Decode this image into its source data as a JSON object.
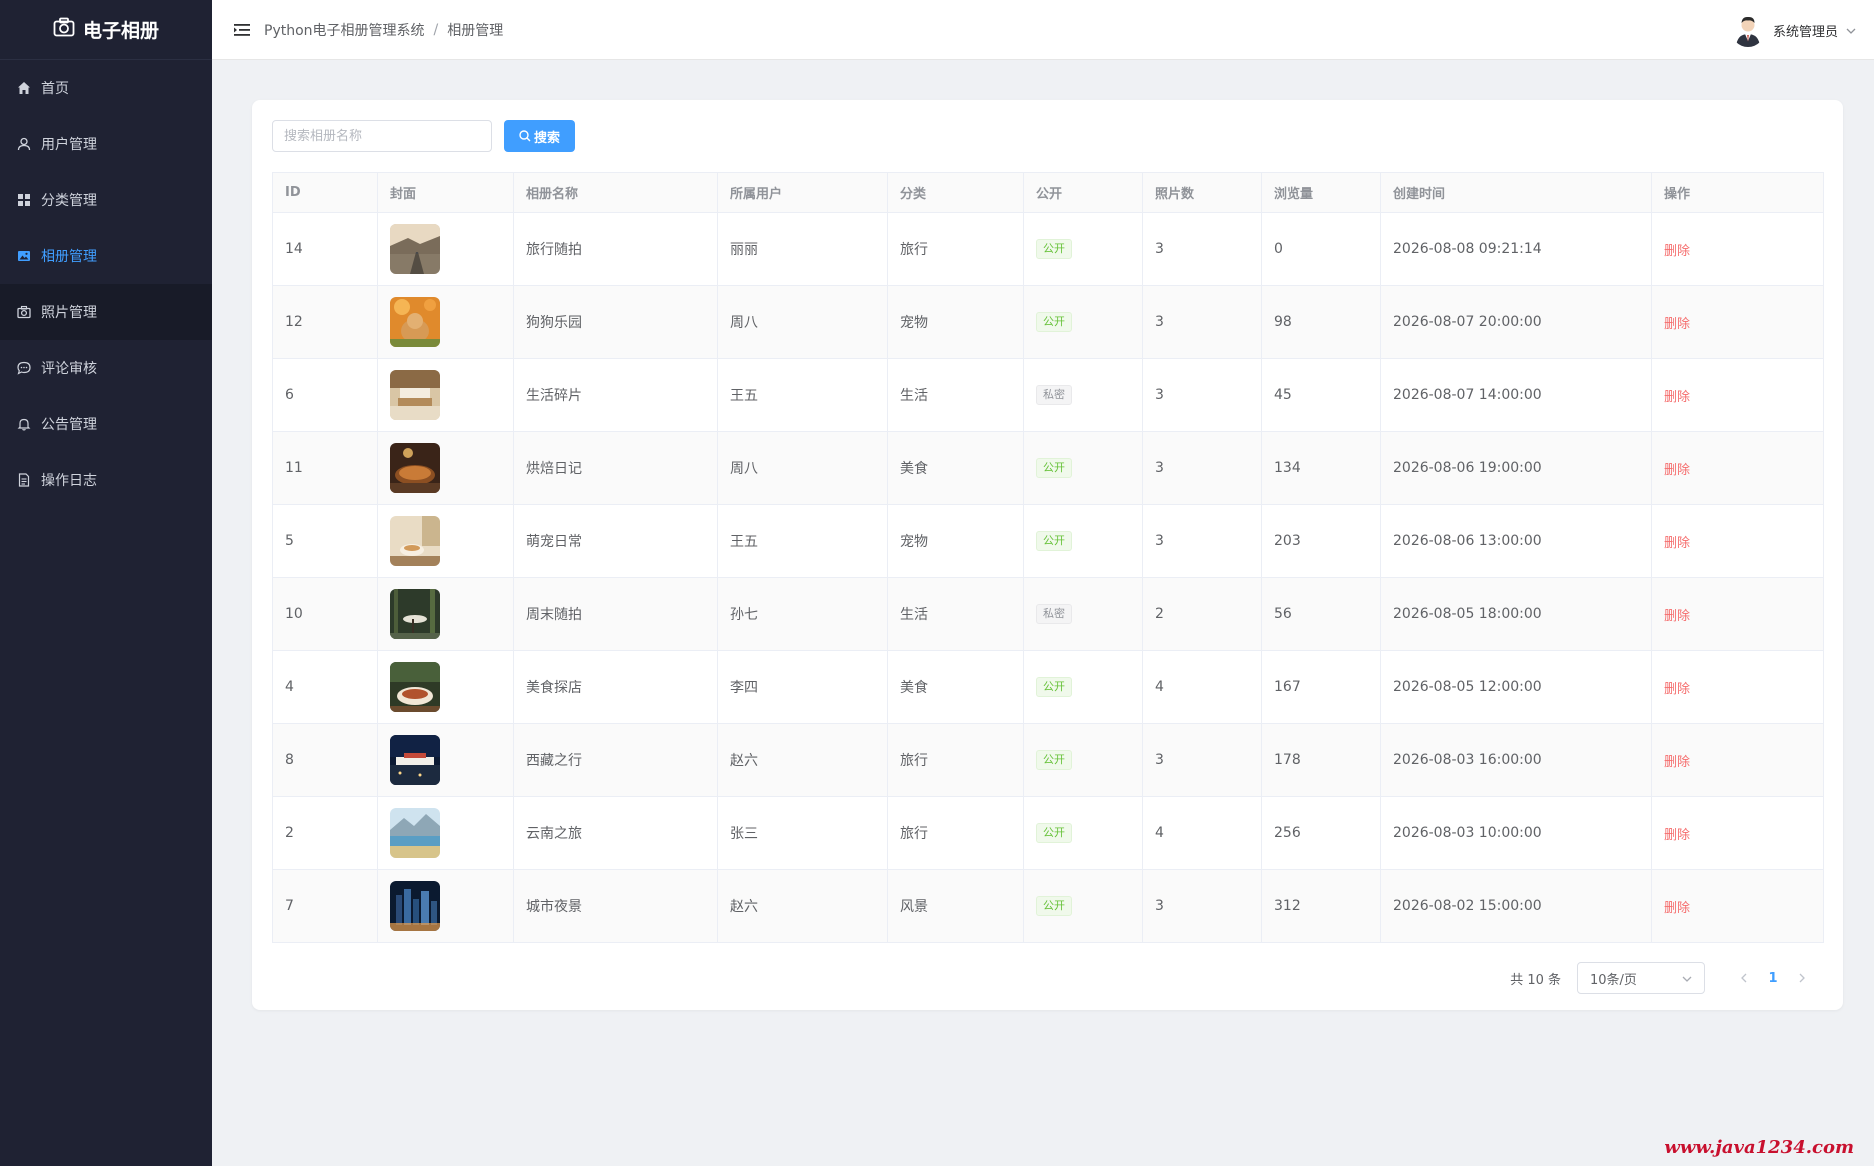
{
  "sidebar": {
    "logo": "电子相册",
    "items": [
      {
        "label": "首页",
        "icon": "home-icon"
      },
      {
        "label": "用户管理",
        "icon": "user-icon"
      },
      {
        "label": "分类管理",
        "icon": "grid-icon"
      },
      {
        "label": "相册管理",
        "icon": "picture-icon"
      },
      {
        "label": "照片管理",
        "icon": "camera-icon"
      },
      {
        "label": "评论审核",
        "icon": "comment-icon"
      },
      {
        "label": "公告管理",
        "icon": "bell-icon"
      },
      {
        "label": "操作日志",
        "icon": "document-icon"
      }
    ],
    "active_index": 3
  },
  "header": {
    "breadcrumb_root": "Python电子相册管理系统",
    "breadcrumb_sep": "/",
    "breadcrumb_current": "相册管理",
    "user_name": "系统管理员"
  },
  "search": {
    "placeholder": "搜索相册名称",
    "button": "搜索"
  },
  "table": {
    "headers": [
      "ID",
      "封面",
      "相册名称",
      "所属用户",
      "分类",
      "公开",
      "照片数",
      "浏览量",
      "创建时间",
      "操作"
    ],
    "rows": [
      {
        "id": "14",
        "name": "旅行随拍",
        "user": "丽丽",
        "category": "旅行",
        "public": "公开",
        "photos": "3",
        "views": "0",
        "created": "2026-08-08 09:21:14",
        "action": "删除"
      },
      {
        "id": "12",
        "name": "狗狗乐园",
        "user": "周八",
        "category": "宠物",
        "public": "公开",
        "photos": "3",
        "views": "98",
        "created": "2026-08-07 20:00:00",
        "action": "删除"
      },
      {
        "id": "6",
        "name": "生活碎片",
        "user": "王五",
        "category": "生活",
        "public": "私密",
        "photos": "3",
        "views": "45",
        "created": "2026-08-07 14:00:00",
        "action": "删除"
      },
      {
        "id": "11",
        "name": "烘焙日记",
        "user": "周八",
        "category": "美食",
        "public": "公开",
        "photos": "3",
        "views": "134",
        "created": "2026-08-06 19:00:00",
        "action": "删除"
      },
      {
        "id": "5",
        "name": "萌宠日常",
        "user": "王五",
        "category": "宠物",
        "public": "公开",
        "photos": "3",
        "views": "203",
        "created": "2026-08-06 13:00:00",
        "action": "删除"
      },
      {
        "id": "10",
        "name": "周末随拍",
        "user": "孙七",
        "category": "生活",
        "public": "私密",
        "photos": "2",
        "views": "56",
        "created": "2026-08-05 18:00:00",
        "action": "删除"
      },
      {
        "id": "4",
        "name": "美食探店",
        "user": "李四",
        "category": "美食",
        "public": "公开",
        "photos": "4",
        "views": "167",
        "created": "2026-08-05 12:00:00",
        "action": "删除"
      },
      {
        "id": "8",
        "name": "西藏之行",
        "user": "赵六",
        "category": "旅行",
        "public": "公开",
        "photos": "3",
        "views": "178",
        "created": "2026-08-03 16:00:00",
        "action": "删除"
      },
      {
        "id": "2",
        "name": "云南之旅",
        "user": "张三",
        "category": "旅行",
        "public": "公开",
        "photos": "4",
        "views": "256",
        "created": "2026-08-03 10:00:00",
        "action": "删除"
      },
      {
        "id": "7",
        "name": "城市夜景",
        "user": "赵六",
        "category": "风景",
        "public": "公开",
        "photos": "3",
        "views": "312",
        "created": "2026-08-02 15:00:00",
        "action": "删除"
      }
    ]
  },
  "pagination": {
    "total": "共 10 条",
    "page_size": "10条/页",
    "current_page": "1"
  },
  "watermark": "www.java1234.com",
  "colors": {
    "accent": "#409eff",
    "sidebar_bg": "#1f2233",
    "public_tag": "#67c23a",
    "private_tag": "#909399",
    "danger": "#f56c6c"
  }
}
